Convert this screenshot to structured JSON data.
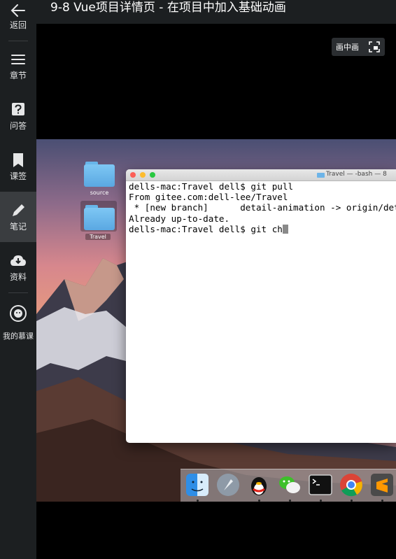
{
  "header": {
    "title": "9-8 Vue项目详情页 - 在项目中加入基础动画"
  },
  "sidebar": {
    "items": [
      {
        "label": "返回",
        "icon": "back-arrow-icon"
      },
      {
        "label": "章节",
        "icon": "menu-icon"
      },
      {
        "label": "问答",
        "icon": "question-icon"
      },
      {
        "label": "课签",
        "icon": "bookmark-icon"
      },
      {
        "label": "笔记",
        "icon": "pencil-icon",
        "active": true
      },
      {
        "label": "资料",
        "icon": "cloud-download-icon"
      },
      {
        "label": "我的慕课",
        "icon": "mooc-avatar-icon"
      }
    ]
  },
  "player": {
    "pip_label": "画中画"
  },
  "desktop": {
    "folders": [
      {
        "label": "source"
      },
      {
        "label": "Travel"
      }
    ],
    "terminal": {
      "title": "Travel — -bash — 8",
      "lines": [
        "dells-mac:Travel dell$ git pull",
        "From gitee.com:dell-lee/Travel",
        " * [new branch]      detail-animation -> origin/detail-animation",
        "Already up-to-date.",
        "dells-mac:Travel dell$ git ch"
      ]
    },
    "dock": [
      "finder-icon",
      "launchpad-icon",
      "qq-icon",
      "wechat-icon",
      "terminal-icon",
      "chrome-icon",
      "sublime-icon"
    ]
  },
  "colors": {
    "sidebar_bg": "#1c1f21",
    "sidebar_active": "#3a3d40",
    "video_bg": "#000000"
  }
}
